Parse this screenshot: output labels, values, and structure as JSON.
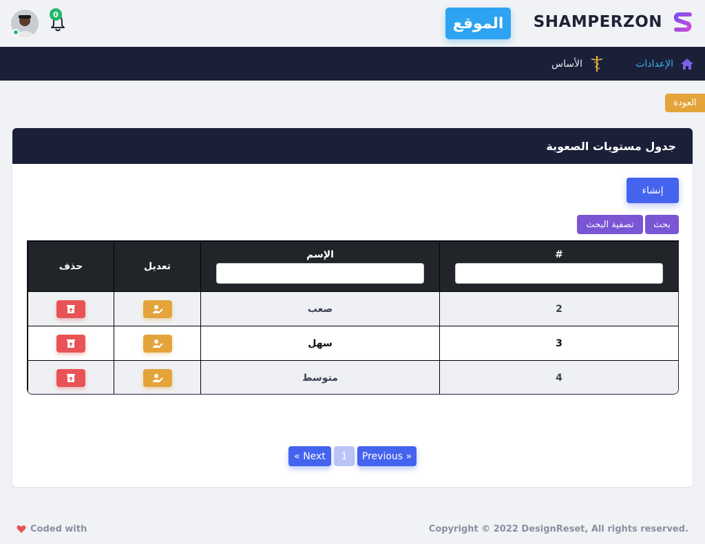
{
  "header": {
    "brand_name": "SHAMPERZON",
    "site_button": "الموقع",
    "notification_count": "0"
  },
  "nav": {
    "settings": "الإعدادات",
    "base": "الأساس"
  },
  "back_button": "العودة",
  "card": {
    "title": "جدول مستويات الصعوبة",
    "create_button": "إنشاء",
    "search_button": "بحث",
    "filter_button": "تصفية البحث",
    "columns": {
      "id": "#",
      "name": "الإسم",
      "edit": "تعديل",
      "delete": "حذف"
    },
    "rows": [
      {
        "id": "2",
        "name": "صعب"
      },
      {
        "id": "3",
        "name": "سهل"
      },
      {
        "id": "4",
        "name": "متوسط"
      }
    ]
  },
  "pagination": {
    "next": "« Next",
    "page": "1",
    "previous": "Previous »"
  },
  "footer": {
    "coded_with": "Coded with",
    "copyright": "Copyright © 2022 DesignReset, All rights reserved."
  },
  "colors": {
    "primary": "#4463ee",
    "navy": "#1b2039",
    "warning": "#e4a43b",
    "danger": "#e85456",
    "purple": "#7a55d4",
    "site_blue": "#2ea3f2"
  }
}
